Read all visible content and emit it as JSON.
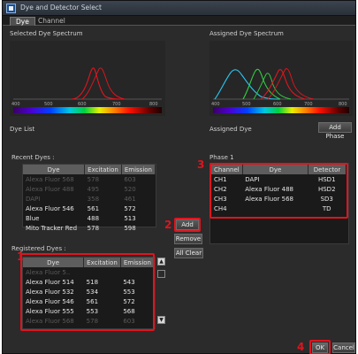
{
  "window": {
    "title": "Dye and Detector Select"
  },
  "tabs": [
    {
      "label": "Dye"
    },
    {
      "label": "Channel"
    }
  ],
  "selected_spectrum": {
    "label": "Selected Dye Spectrum",
    "ticks": [
      "400",
      "500",
      "600",
      "700",
      "800"
    ]
  },
  "assigned_spectrum": {
    "label": "Assigned Dye Spectrum",
    "ticks": [
      "400",
      "500",
      "600",
      "700",
      "800"
    ]
  },
  "dye_list": {
    "label": "Dye List"
  },
  "assigned_dye": {
    "label": "Assigned Dye",
    "add_phase_button": "Add Phase"
  },
  "recent_dyes": {
    "label": "Recent Dyes :",
    "headers": [
      "Dye",
      "Excitation",
      "Emission"
    ],
    "rows": [
      {
        "dye": "Alexa Fluor 568",
        "ex": "578",
        "em": "603",
        "dim": true
      },
      {
        "dye": "Alexa Fluor 488",
        "ex": "495",
        "em": "520",
        "dim": true
      },
      {
        "dye": "DAPI",
        "ex": "358",
        "em": "461",
        "dim": true
      },
      {
        "dye": "Alexa Fluor 546",
        "ex": "561",
        "em": "572",
        "dim": false
      },
      {
        "dye": "Blue",
        "ex": "488",
        "em": "513",
        "dim": false
      },
      {
        "dye": "Mito Tracker Red",
        "ex": "578",
        "em": "598",
        "dim": false
      }
    ]
  },
  "registered_dyes": {
    "label": "Registered Dyes :",
    "headers": [
      "Dye",
      "Excitation",
      "Emission"
    ],
    "rows": [
      {
        "dye": "Alexa Fluor 5..",
        "ex": "",
        "em": "",
        "dim": true
      },
      {
        "dye": "Alexa Fluor 514",
        "ex": "518",
        "em": "543",
        "dim": false
      },
      {
        "dye": "Alexa Fluor 532",
        "ex": "534",
        "em": "553",
        "dim": false
      },
      {
        "dye": "Alexa Fluor 546",
        "ex": "561",
        "em": "572",
        "dim": false
      },
      {
        "dye": "Alexa Fluor 555",
        "ex": "553",
        "em": "568",
        "dim": false
      },
      {
        "dye": "Alexa Fluor 568",
        "ex": "578",
        "em": "603",
        "dim": true
      }
    ]
  },
  "actions": {
    "add": "Add",
    "remove": "Remove",
    "all_clear": "All Clear"
  },
  "phase": {
    "label": "Phase 1",
    "headers": [
      "Channel",
      "Dye",
      "Detector"
    ],
    "rows": [
      {
        "channel": "CH1",
        "dye": "DAPI",
        "detector": "HSD1"
      },
      {
        "channel": "CH2",
        "dye": "Alexa Fluor 488",
        "detector": "HSD2"
      },
      {
        "channel": "CH3",
        "dye": "Alexa Fluor 568",
        "detector": "SD3"
      },
      {
        "channel": "CH4",
        "dye": "",
        "detector": "TD"
      }
    ]
  },
  "footer": {
    "ok": "OK",
    "cancel": "Cancel"
  },
  "callouts": {
    "one": "1",
    "two": "2",
    "three": "3",
    "four": "4"
  },
  "colors": {
    "highlight_red": "#e0141e",
    "bg": "#2b2b2b",
    "header": "#5d5d5d"
  }
}
